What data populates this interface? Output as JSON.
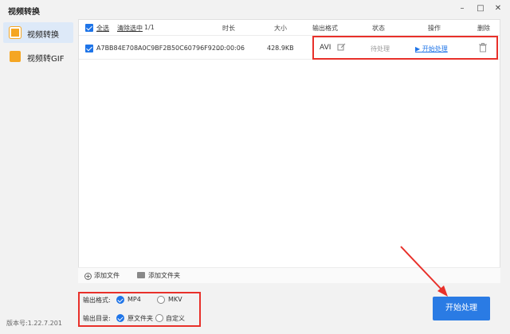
{
  "window": {
    "title": "视频转换"
  },
  "sidebar": {
    "items": [
      {
        "label": "视频转换",
        "icon": "video-convert-icon",
        "active": true
      },
      {
        "label": "视频转GIF",
        "icon": "gif-icon",
        "active": false
      }
    ],
    "version": "版本号:1.22.7.201"
  },
  "table": {
    "header": {
      "select_all": "全选",
      "clear_selected": "清除选中",
      "count": "1/1",
      "duration": "时长",
      "size": "大小",
      "format": "输出格式",
      "status": "状态",
      "action": "操作",
      "delete": "删除"
    },
    "rows": [
      {
        "name": "A7BB84E708A0C9BF2B50C60796F92...",
        "duration": "00:00:06",
        "size": "428.9KB",
        "format": "AVI",
        "status": "待处理",
        "action": "开始处理"
      }
    ]
  },
  "add_bar": {
    "add_file": "添加文件",
    "add_folder": "添加文件夹"
  },
  "options": {
    "format_label": "输出格式:",
    "format_options": [
      "MP4",
      "MKV"
    ],
    "format_selected": "MP4",
    "dir_label": "输出目录:",
    "dir_options": [
      "原文件夹",
      "自定义"
    ],
    "dir_selected": "原文件夹"
  },
  "start_button": "开始处理",
  "colors": {
    "accent": "#2a7be4",
    "annotation": "#e8302a"
  }
}
